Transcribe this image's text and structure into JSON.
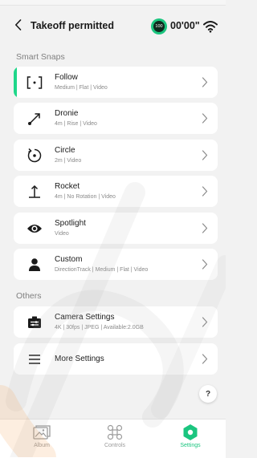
{
  "header": {
    "back_icon": "chevron-left-icon",
    "title": "Takeoff permitted",
    "battery_text": "100",
    "timer": "00'00\"",
    "wifi_icon": "wifi-icon"
  },
  "sections": [
    {
      "label": "Smart Snaps",
      "items": [
        {
          "name": "Follow",
          "detail": "Medium | Flat | Video",
          "icon": "follow-bracket-icon",
          "selected": true
        },
        {
          "name": "Dronie",
          "detail": "4m | Rise | Video",
          "icon": "dronie-arrow-icon"
        },
        {
          "name": "Circle",
          "detail": "2m | Video",
          "icon": "circle-orbit-icon"
        },
        {
          "name": "Rocket",
          "detail": "4m | No Rotation | Video",
          "icon": "rocket-up-icon"
        },
        {
          "name": "Spotlight",
          "detail": "Video",
          "icon": "eye-icon"
        },
        {
          "name": "Custom",
          "detail": "DirectionTrack | Medium | Flat | Video",
          "icon": "person-icon"
        }
      ]
    },
    {
      "label": "Others",
      "items": [
        {
          "name": "Camera Settings",
          "detail": "4K | 30fps | JPEG | Available:2.0GB",
          "icon": "camera-settings-icon"
        },
        {
          "name": "More Settings",
          "detail": "",
          "icon": "menu-lines-icon"
        }
      ]
    }
  ],
  "help_label": "?",
  "tabs": [
    {
      "label": "Album",
      "icon": "album-icon",
      "active": false
    },
    {
      "label": "Controls",
      "icon": "controls-icon",
      "active": false
    },
    {
      "label": "Settings",
      "icon": "settings-hexagon-icon",
      "active": true
    }
  ],
  "colors": {
    "accent": "#1bc57f",
    "selected_bar": "#1fd78a",
    "background": "#f2f2f2",
    "card": "#ffffff",
    "watermark": "#f3a052"
  }
}
